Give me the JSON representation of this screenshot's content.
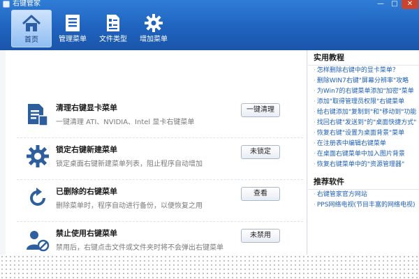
{
  "window": {
    "title": "右键管家",
    "minimize": "—",
    "maximize": "□",
    "close": "✕"
  },
  "nav": [
    {
      "label": "首页",
      "icon": "home-icon",
      "active": true
    },
    {
      "label": "管理菜单",
      "icon": "menu-list-icon",
      "active": false
    },
    {
      "label": "文件类型",
      "icon": "file-type-icon",
      "active": false
    },
    {
      "label": "增加菜单",
      "icon": "gear-icon",
      "active": false
    }
  ],
  "features": [
    {
      "title": "清理右键显卡菜单",
      "desc": "一键清理 ATI、NVIDIA、Intel 显卡右键菜单",
      "button": "一键清理",
      "icon": "document-clean-icon"
    },
    {
      "title": "锁定右键新建菜单",
      "desc": "锁定桌面右键新建菜单列表，阻止程序自动增加",
      "button": "未锁定",
      "icon": "gear-icon"
    },
    {
      "title": "已删除的右键菜单",
      "desc": "删除菜单时，程序自动进行备份，以便恢复之用",
      "button": "查看",
      "icon": "refresh-arrow-icon"
    },
    {
      "title": "禁止使用右键菜单",
      "desc": "禁用后，右键点击文件或文件夹时将不会弹出右键菜单",
      "button": "未禁用",
      "icon": "user-block-icon"
    }
  ],
  "sidebar": {
    "tutorials_title": "实用教程",
    "tutorials": [
      "怎样删除右键中的显卡菜单？",
      "删除WIN7右键\"屏幕分辨率\"攻略",
      "为Win7的右键菜单添加\"加密\"菜单",
      "添加\"取得管理员权限\"右键菜单",
      "给右键添加\"复制到\"和\"移动到\"功能",
      "找回右键\"发送到\"的\"桌面快捷方式\"",
      "恢复右键\"设置为桌面背景\"菜单",
      "在注册表中编辑右键菜单",
      "在桌面右键菜单中加入图片背景",
      "恢复右键菜单中的\"资源管理器\""
    ],
    "software_title": "推荐软件",
    "software": [
      "右键管家官方网站",
      "PPS网络电视(节目丰富的网络电视)"
    ]
  },
  "colors": {
    "header": "#1f63bf",
    "link": "#1e5fb5",
    "icon": "#2d5f9e"
  }
}
